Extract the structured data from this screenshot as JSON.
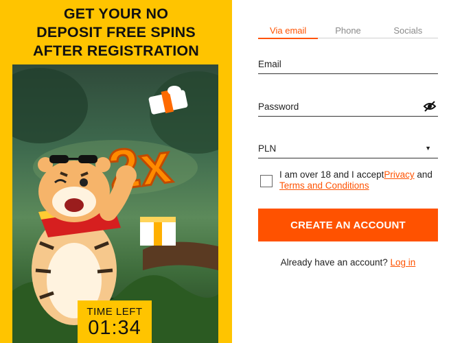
{
  "promo": {
    "title_lines": [
      "GET YOUR NO",
      "DEPOSIT FREE SPINS",
      "AFTER REGISTRATION"
    ],
    "multiplier": "2x",
    "timer_label": "TIME LEFT",
    "timer_value": "01:34"
  },
  "tabs": [
    {
      "label": "Via email",
      "active": true
    },
    {
      "label": "Phone",
      "active": false
    },
    {
      "label": "Socials",
      "active": false
    }
  ],
  "fields": {
    "email_label": "Email",
    "password_label": "Password",
    "currency_value": "PLN"
  },
  "agreement": {
    "text_before": "I am over 18 and I accept",
    "privacy_link": "Privacy",
    "text_middle": " and ",
    "terms_link": "Terms and Conditions",
    "checked": false
  },
  "cta": {
    "label": "CREATE AN ACCOUNT"
  },
  "login": {
    "prompt": "Already have an account? ",
    "link": "Log in"
  },
  "colors": {
    "accent": "#ff5200",
    "promo_bg": "#ffc400"
  },
  "icons": {
    "password_toggle": "eye-slash-icon",
    "select_caret": "caret-down-icon"
  }
}
